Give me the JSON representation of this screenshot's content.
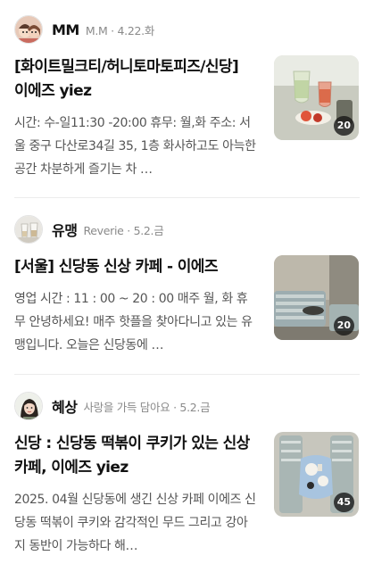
{
  "posts": [
    {
      "author": "MM",
      "meta": "M.M · 4.22.화",
      "title": "[화이트밀크티/허니토마토피즈/신당] 이에즈 yiez",
      "snippet": "시간: 수-일11:30 -20:00 휴무: 월,화 주소: 서울 중구 다산로34길 35, 1층 화사하고도 아늑한 공간 차분하게 즐기는 차 …",
      "image_count": "20",
      "avatar_icon": "cartoon-couple-avatar",
      "thumb_icon": "drinks-on-table-photo"
    },
    {
      "author": "유맹",
      "meta": "Reverie · 5.2.금",
      "title": "[서울] 신당동 신상 카페 - 이에즈",
      "snippet": "영업 시간 : 11 : 00 ~ 20 : 00 매주 월, 화 휴무 안녕하세요! 매주 핫플을 찾아다니고 있는 유맹입니다. 오늘은 신당동에 …",
      "image_count": "20",
      "avatar_icon": "glass-cups-avatar",
      "thumb_icon": "cafe-sofa-photo"
    },
    {
      "author": "혜상",
      "meta": "사랑을 가득 담아요 · 5.2.금",
      "title": "신당 : 신당동 떡볶이 쿠키가 있는 신상 카페, 이에즈 yiez",
      "snippet": "2025. 04월 신당동에 생긴 신상 카페 이에즈 신당동 떡볶이 쿠키와 감각적인 무드 그리고 강아지 동반이 가능하다 해…",
      "image_count": "45",
      "avatar_icon": "woman-portrait-avatar",
      "thumb_icon": "table-top-view-photo"
    }
  ]
}
